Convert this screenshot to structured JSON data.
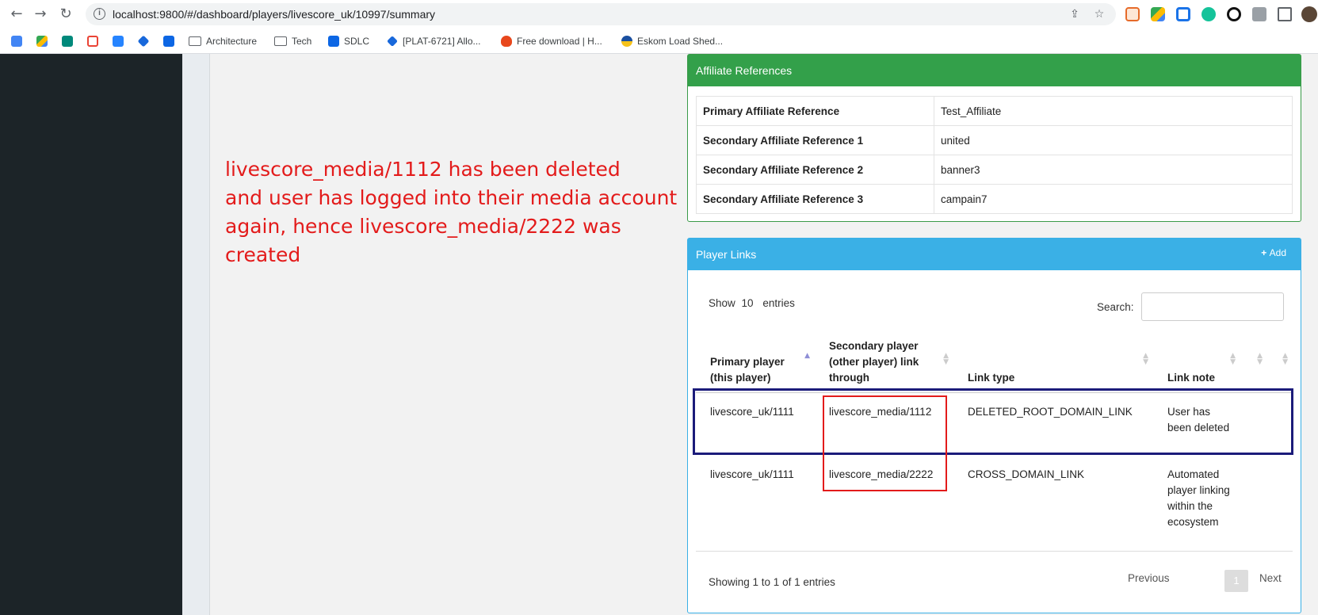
{
  "browser": {
    "url": "localhost:9800/#/dashboard/players/livescore_uk/10997/summary",
    "bookmarks": [
      {
        "label": "Architecture",
        "icon": "folder-icon"
      },
      {
        "label": "Tech",
        "icon": "folder-icon"
      },
      {
        "label": "SDLC",
        "icon": "confluence-icon"
      },
      {
        "label": "[PLAT-6721] Allo...",
        "icon": "jira-icon"
      },
      {
        "label": "Free download | H...",
        "icon": "flame-icon"
      },
      {
        "label": "Eskom Load Shed...",
        "icon": "eskom-icon"
      }
    ]
  },
  "annotation": {
    "line1": "livescore_media/1112 has been deleted",
    "line2": "and user has logged into their media account",
    "line3": "again, hence livescore_media/2222 was created"
  },
  "affiliate": {
    "title": "Affiliate References",
    "rows": [
      {
        "key": "Primary Affiliate Reference",
        "value": "Test_Affiliate"
      },
      {
        "key": "Secondary Affiliate Reference 1",
        "value": "united"
      },
      {
        "key": "Secondary Affiliate Reference 2",
        "value": "banner3"
      },
      {
        "key": "Secondary Affiliate Reference 3",
        "value": "campain7"
      }
    ]
  },
  "player_links": {
    "title": "Player Links",
    "add_label": "Add",
    "length_prefix": "Show",
    "length_value": "10",
    "length_suffix": "entries",
    "search_label": "Search:",
    "columns": [
      "Primary player (this player)",
      "Secondary player (other player) link through",
      "Link type",
      "Link note"
    ],
    "rows": [
      {
        "primary": "livescore_uk/1111",
        "secondary": "livescore_media/1112",
        "type": "DELETED_ROOT_DOMAIN_LINK",
        "note": "User has been deleted"
      },
      {
        "primary": "livescore_uk/1111",
        "secondary": "livescore_media/2222",
        "type": "CROSS_DOMAIN_LINK",
        "note": "Automated player linking within the ecosystem"
      }
    ],
    "info": "Showing 1 to 1 of 1 entries",
    "prev_label": "Previous",
    "page": "1",
    "next_label": "Next"
  },
  "colors": {
    "affiliate_header": "#33a04a",
    "player_links_header": "#3ab0e6",
    "annotation_text": "#e31b1b",
    "highlight_blue": "#1b1b7a",
    "highlight_red": "#e31b1b"
  }
}
